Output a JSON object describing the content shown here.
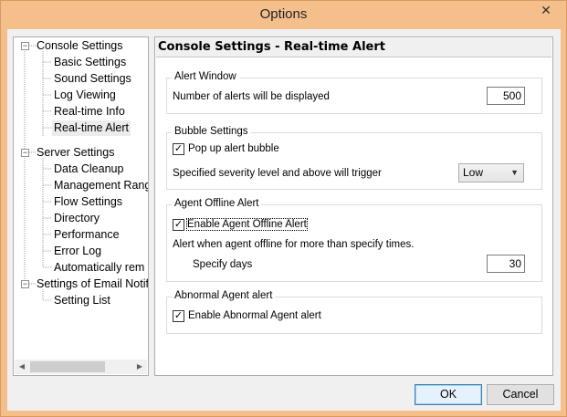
{
  "window": {
    "title": "Options",
    "close_glyph": "✕"
  },
  "tree": {
    "items": [
      {
        "label": "Console Settings",
        "expander": "−"
      },
      {
        "label": "Basic Settings"
      },
      {
        "label": "Sound Settings"
      },
      {
        "label": "Log Viewing"
      },
      {
        "label": "Real-time Info"
      },
      {
        "label": "Real-time Alert",
        "selected": true
      },
      {
        "label": "Server Settings",
        "expander": "−"
      },
      {
        "label": "Data Cleanup"
      },
      {
        "label": "Management Rang"
      },
      {
        "label": "Flow Settings"
      },
      {
        "label": "Directory"
      },
      {
        "label": "Performance"
      },
      {
        "label": "Error Log"
      },
      {
        "label": "Automatically rem"
      },
      {
        "label": "Settings of Email Notif",
        "expander": "−"
      },
      {
        "label": "Setting List"
      }
    ],
    "scroll_left": "◀",
    "scroll_right": "▶"
  },
  "pane": {
    "title": "Console Settings - Real-time Alert",
    "alert_window": {
      "label": "Alert Window",
      "count_label": "Number of alerts will be displayed",
      "count_value": "500"
    },
    "bubble_settings": {
      "label": "Bubble Settings",
      "popup_label": "Pop up alert bubble",
      "popup_checked": true,
      "severity_label": "Specified severity level and above will trigger",
      "severity_value": "Low",
      "caret": "▼"
    },
    "agent_offline": {
      "label": "Agent Offline Alert",
      "enable_label": "Enable Agent Offline Alert",
      "enable_checked": true,
      "desc": "Alert when agent offline for more than specify times.",
      "days_label": "Specify days",
      "days_value": "30"
    },
    "abnormal_agent": {
      "label": "Abnormal Agent alert",
      "enable_label": "Enable Abnormal Agent alert",
      "enable_checked": true
    }
  },
  "buttons": {
    "ok": "OK",
    "cancel": "Cancel"
  },
  "check_glyph": "✓"
}
